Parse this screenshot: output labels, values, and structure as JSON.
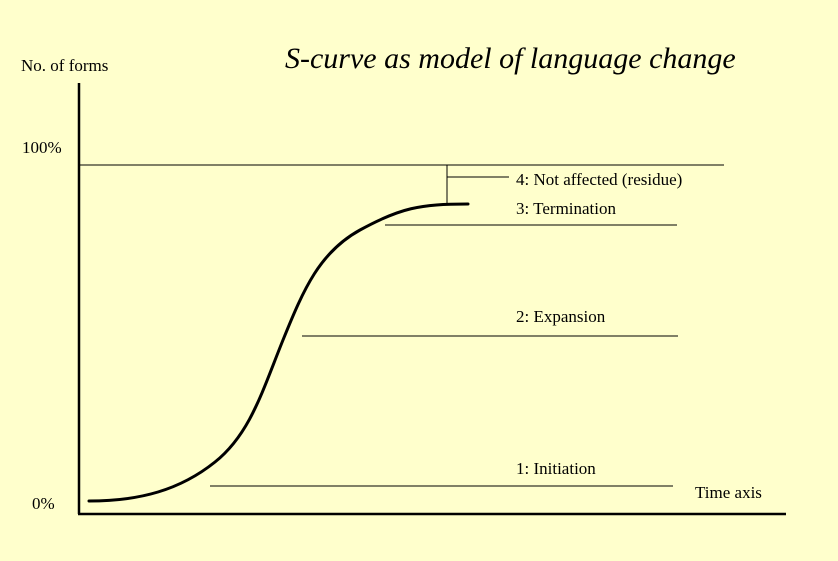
{
  "title": "S-curve as model of language change",
  "y_axis": {
    "label": "No. of forms",
    "tick_top": "100%",
    "tick_bottom": "0%"
  },
  "x_axis": {
    "label": "Time axis"
  },
  "stages": [
    {
      "label": "1: Initiation"
    },
    {
      "label": "2: Expansion"
    },
    {
      "label": "3: Termination"
    },
    {
      "label": "4: Not affected (residue)"
    }
  ],
  "colors": {
    "background": "#ffffcc",
    "ink": "#000000"
  }
}
